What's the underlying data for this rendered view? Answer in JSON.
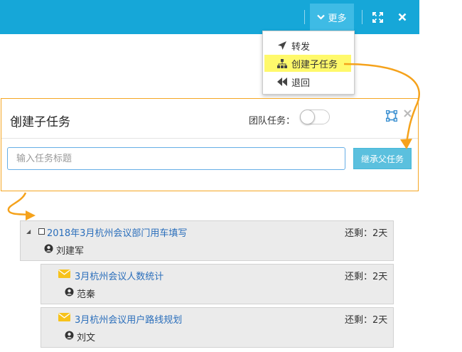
{
  "topbar": {
    "more_label": "更多",
    "more_icon": "chevron-down-icon",
    "expand_icon": "expand-icon",
    "close_icon": "close-icon",
    "bg_color": "#16a7d8",
    "active_color": "#3ebbe5"
  },
  "dropdown": {
    "items": [
      {
        "label": "转发",
        "icon": "forward-arrow-icon"
      },
      {
        "label": "创建子任务",
        "icon": "sitemap-icon",
        "highlighted": true
      },
      {
        "label": "退回",
        "icon": "backward-icon"
      }
    ],
    "highlight_color": "#fff96b"
  },
  "panel": {
    "title": "创建子任务",
    "team_task_label": "团队任务：",
    "team_task_enabled": false,
    "input_placeholder": "输入任务标题",
    "inherit_button_label": "继承父任务",
    "border_color": "#f5a623"
  },
  "tasks": [
    {
      "title": "2018年3月杭州会议部门用车填写",
      "remaining": "还剩：2天",
      "assignee": "刘建军",
      "kind": "parent"
    },
    {
      "title": "3月杭州会议人数统计",
      "remaining": "还剩：2天",
      "assignee": "范秦",
      "kind": "child"
    },
    {
      "title": "3月杭州会议用户路线规划",
      "remaining": "还剩：2天",
      "assignee": "刘文",
      "kind": "child"
    }
  ],
  "annotation_color": "#f5a21b"
}
